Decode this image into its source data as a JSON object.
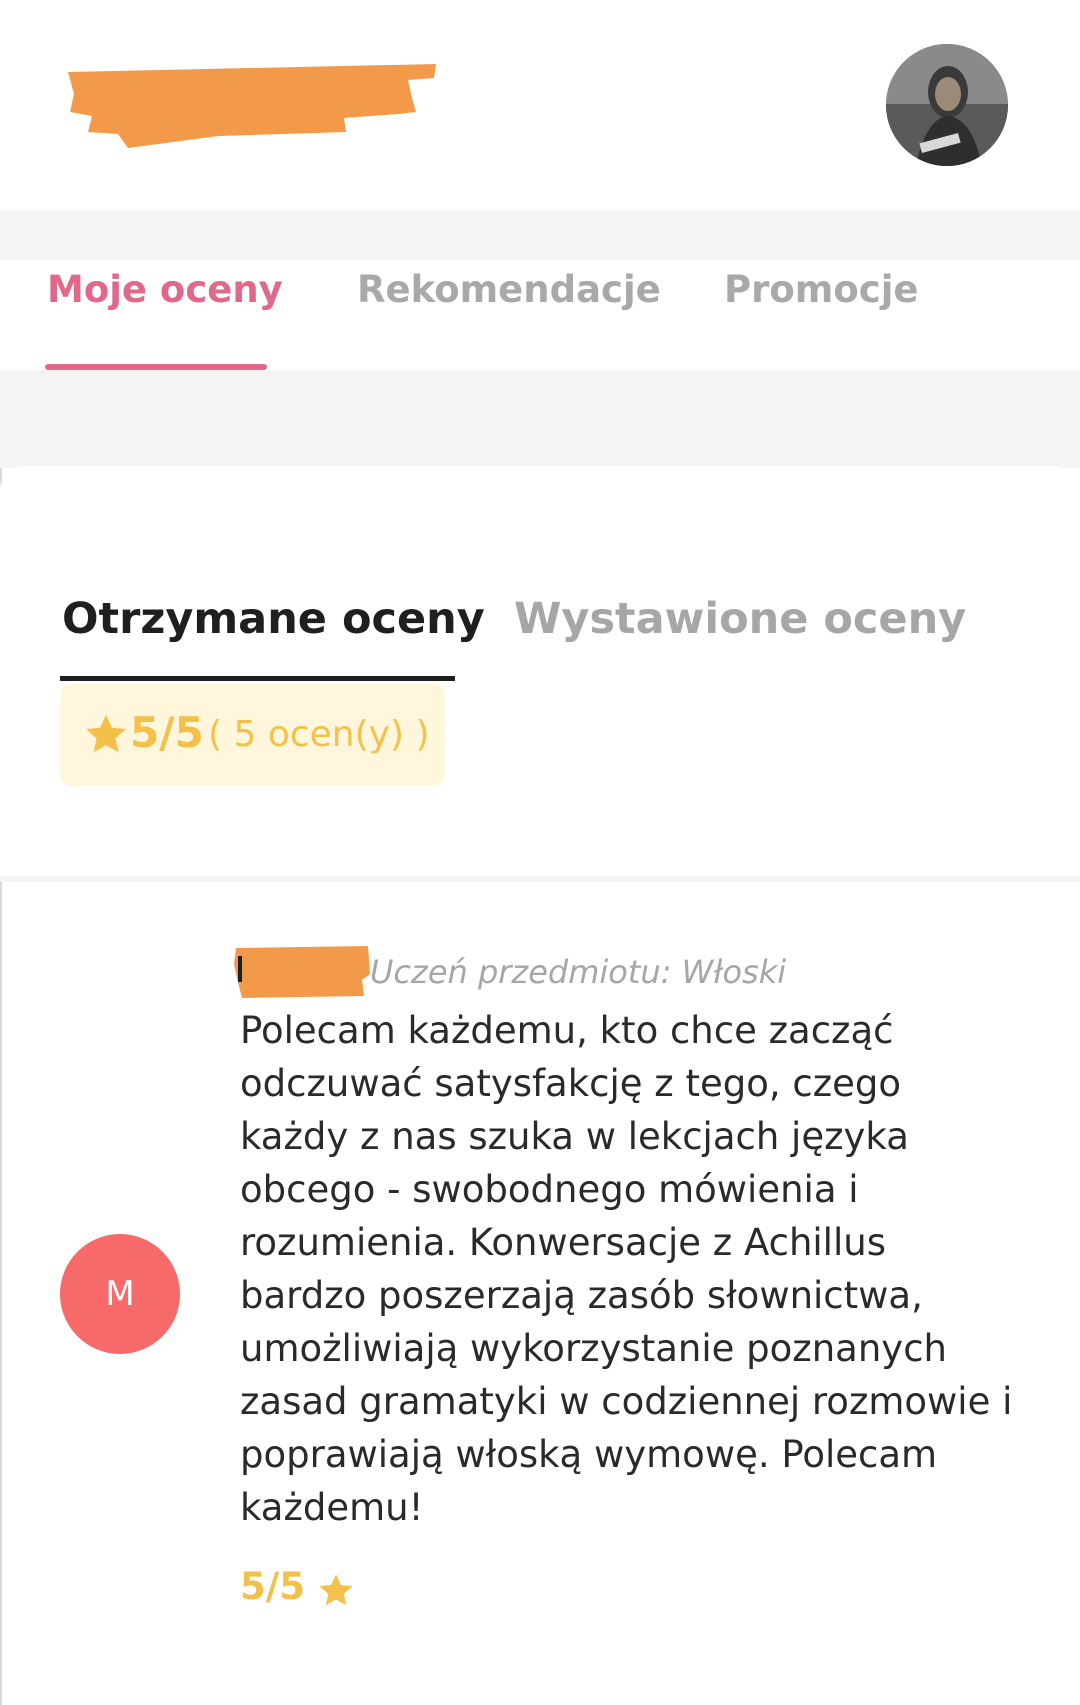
{
  "header": {
    "logo_redacted": true,
    "avatar_icon": "profile-photo"
  },
  "main_tabs": [
    {
      "label": "Moje oceny",
      "active": true
    },
    {
      "label": "Rekomendacje",
      "active": false
    },
    {
      "label": "Promocje",
      "active": false
    }
  ],
  "ratings": {
    "sub_tabs": [
      {
        "label": "Otrzymane oceny",
        "active": true
      },
      {
        "label": "Wystawione oceny",
        "active": false
      }
    ],
    "summary": {
      "icon": "star-icon",
      "score": "5/5",
      "count": "( 5 ocen(y) )"
    }
  },
  "review": {
    "avatar_letter": "M",
    "subject": "Uczeń przedmiotu: Włoski",
    "text": "Polecam każdemu, kto chce zacząć odczuwać satysfakcję z tego, czego każdy z nas szuka w lekcjach języka obcego - swobodnego mówienia i rozumienia. Konwersacje z Achillus bardzo poszerzają zasób słownictwa, umożliwiają wykorzystanie poznanych zasad gramatyki w codziennej rozmowie i poprawiają włoską wymowę. Polecam każdemu!",
    "rating": "5/5",
    "rating_icon": "star-icon"
  },
  "colors": {
    "accent_pink": "#e0688a",
    "star_gold": "#f4c04a",
    "rating_bg": "#fff6dc",
    "avatar_red": "#f76a6a",
    "redaction_orange": "#f2994a"
  }
}
